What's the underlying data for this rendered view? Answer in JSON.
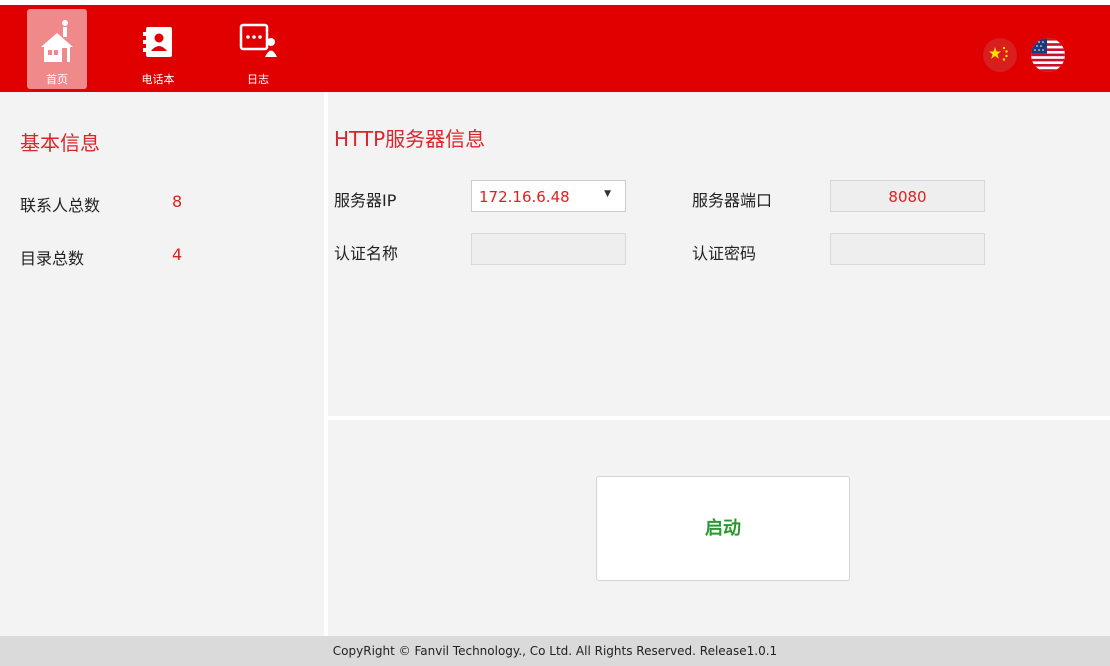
{
  "nav": {
    "items": [
      {
        "label": "首页",
        "icon": "home-icon",
        "active": true
      },
      {
        "label": "电话本",
        "icon": "phonebook-icon",
        "active": false
      },
      {
        "label": "日志",
        "icon": "log-icon",
        "active": false
      }
    ]
  },
  "languages": [
    {
      "icon": "china-flag-icon"
    },
    {
      "icon": "us-flag-icon"
    }
  ],
  "basic_info": {
    "title": "基本信息",
    "rows": [
      {
        "label": "联系人总数",
        "value": "8"
      },
      {
        "label": "目录总数",
        "value": "4"
      }
    ]
  },
  "http_server": {
    "title": "HTTP服务器信息",
    "server_ip_label": "服务器IP",
    "server_ip_value": "172.16.6.48",
    "server_port_label": "服务器端口",
    "server_port_value": "8080",
    "auth_name_label": "认证名称",
    "auth_name_value": "",
    "auth_password_label": "认证密码",
    "auth_password_value": ""
  },
  "actions": {
    "start_label": "启动"
  },
  "footer": {
    "text": "CopyRight © Fanvil Technology., Co Ltd. All Rights Reserved.  Release1.0.1"
  },
  "colors": {
    "header_bg": "#e00000",
    "accent_red": "#e02020",
    "title_red": "#d9262b",
    "start_green": "#2a9a30",
    "panel_bg": "#f3f3f3",
    "footer_bg": "#dadada"
  }
}
